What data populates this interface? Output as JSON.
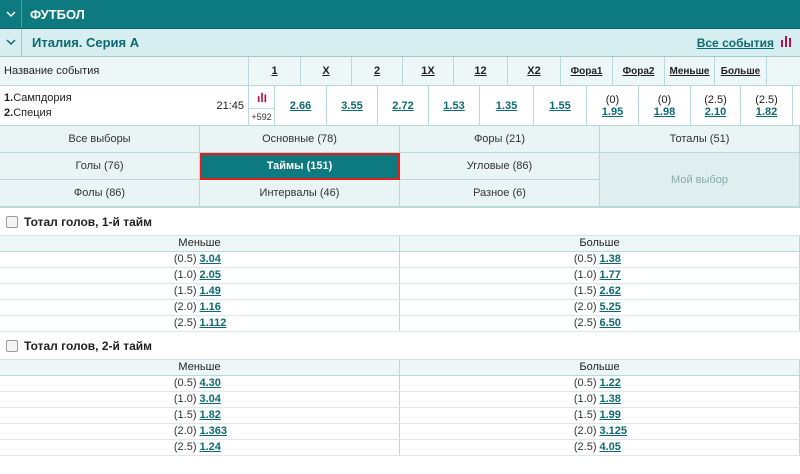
{
  "sport": {
    "title": "ФУТБОЛ"
  },
  "league": {
    "title": "Италия. Серия А",
    "all_events": "Все события"
  },
  "odds_header": {
    "name_label": "Название события",
    "columns": [
      "1",
      "X",
      "2",
      "1X",
      "12",
      "X2",
      "Фора1",
      "Фора2",
      "Меньше",
      "Больше"
    ]
  },
  "event": {
    "team1_num": "1.",
    "team1": "Сампдория",
    "team2_num": "2.",
    "team2": "Специя",
    "time": "21:45",
    "more": "+592",
    "odds": {
      "w1": "2.66",
      "x": "3.55",
      "w2": "2.72",
      "x1": "1.53",
      "x12": "1.35",
      "x2": "1.55",
      "f1_hdc": "(0)",
      "f1": "1.95",
      "f2_hdc": "(0)",
      "f2": "1.98",
      "under_hdc": "(2.5)",
      "under": "2.10",
      "over_hdc": "(2.5)",
      "over": "1.82"
    }
  },
  "filters": {
    "all": "Все выборы",
    "main": "Основные (78)",
    "fora": "Форы (21)",
    "totals": "Тоталы (51)",
    "goals": "Голы (76)",
    "halves": "Таймы (151)",
    "corners": "Угловые (86)",
    "my": "Мой выбор",
    "fouls": "Фолы (86)",
    "intervals": "Интервалы (46)",
    "misc": "Разное (6)"
  },
  "markets": [
    {
      "title": "Тотал голов, 1-й тайм",
      "under_label": "Меньше",
      "over_label": "Больше",
      "rows": [
        {
          "u_h": "(0.5)",
          "u": "3.04",
          "o_h": "(0.5)",
          "o": "1.38"
        },
        {
          "u_h": "(1.0)",
          "u": "2.05",
          "o_h": "(1.0)",
          "o": "1.77"
        },
        {
          "u_h": "(1.5)",
          "u": "1.49",
          "o_h": "(1.5)",
          "o": "2.62"
        },
        {
          "u_h": "(2.0)",
          "u": "1.16",
          "o_h": "(2.0)",
          "o": "5.25"
        },
        {
          "u_h": "(2.5)",
          "u": "1.112",
          "o_h": "(2.5)",
          "o": "6.50"
        }
      ]
    },
    {
      "title": "Тотал голов, 2-й тайм",
      "under_label": "Меньше",
      "over_label": "Больше",
      "rows": [
        {
          "u_h": "(0.5)",
          "u": "4.30",
          "o_h": "(0.5)",
          "o": "1.22"
        },
        {
          "u_h": "(1.0)",
          "u": "3.04",
          "o_h": "(1.0)",
          "o": "1.38"
        },
        {
          "u_h": "(1.5)",
          "u": "1.82",
          "o_h": "(1.5)",
          "o": "1.99"
        },
        {
          "u_h": "(2.0)",
          "u": "1.363",
          "o_h": "(2.0)",
          "o": "3.125"
        },
        {
          "u_h": "(2.5)",
          "u": "1.24",
          "o_h": "(2.5)",
          "o": "4.05"
        }
      ]
    }
  ],
  "colors": {
    "teal": "#0d7a80",
    "link": "#0d6a70",
    "stats": "#b0124a",
    "highlight": "#e0201e"
  }
}
